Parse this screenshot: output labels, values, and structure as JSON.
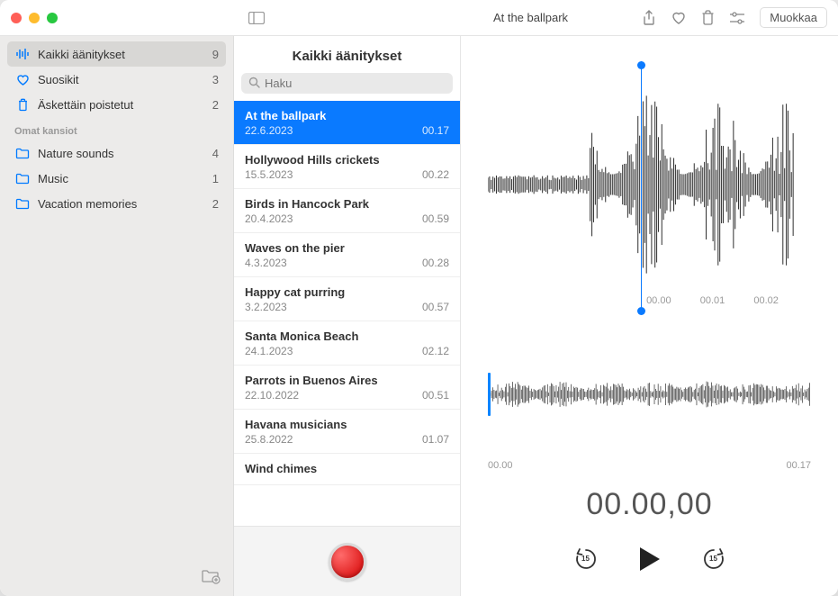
{
  "window_title": "At the ballpark",
  "edit_label": "Muokkaa",
  "sidebar": {
    "smart": [
      {
        "icon": "waveform",
        "label": "Kaikki äänitykset",
        "count": "9",
        "active": true
      },
      {
        "icon": "heart",
        "label": "Suosikit",
        "count": "3",
        "active": false
      },
      {
        "icon": "trash",
        "label": "Äskettäin poistetut",
        "count": "2",
        "active": false
      }
    ],
    "folders_header": "Omat kansiot",
    "folders": [
      {
        "label": "Nature sounds",
        "count": "4"
      },
      {
        "label": "Music",
        "count": "1"
      },
      {
        "label": "Vacation memories",
        "count": "2"
      }
    ]
  },
  "list": {
    "header": "Kaikki äänitykset",
    "search_placeholder": "Haku",
    "items": [
      {
        "title": "At the ballpark",
        "date": "22.6.2023",
        "dur": "00.17",
        "selected": true
      },
      {
        "title": "Hollywood Hills crickets",
        "date": "15.5.2023",
        "dur": "00.22"
      },
      {
        "title": "Birds in Hancock Park",
        "date": "20.4.2023",
        "dur": "00.59"
      },
      {
        "title": "Waves on the pier",
        "date": "4.3.2023",
        "dur": "00.28"
      },
      {
        "title": "Happy cat purring",
        "date": "3.2.2023",
        "dur": "00.57"
      },
      {
        "title": "Santa Monica Beach",
        "date": "24.1.2023",
        "dur": "02.12"
      },
      {
        "title": "Parrots in Buenos Aires",
        "date": "22.10.2022",
        "dur": "00.51"
      },
      {
        "title": "Havana musicians",
        "date": "25.8.2022",
        "dur": "01.07"
      },
      {
        "title": "Wind chimes",
        "date": "",
        "dur": ""
      }
    ]
  },
  "detail": {
    "marks_top": [
      "00.00",
      "00.01",
      "00.02"
    ],
    "marks_bottom_start": "00.00",
    "marks_bottom_end": "00.17",
    "timecode": "00.00,00",
    "skip_amount": "15"
  }
}
